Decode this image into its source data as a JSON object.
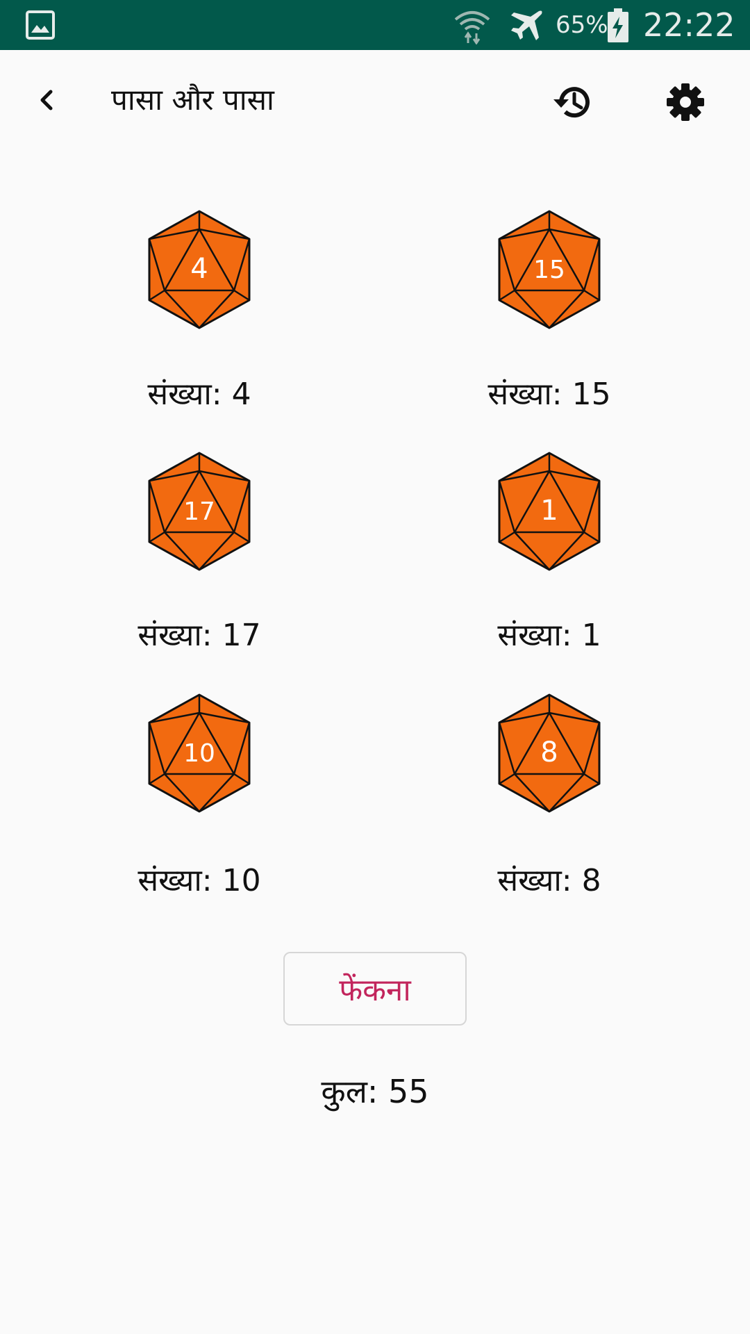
{
  "status_bar": {
    "battery_percent": "65%",
    "time": "22:22",
    "icons": [
      "gallery-icon",
      "wifi-icon",
      "airplane-mode-icon",
      "battery-charging-icon"
    ]
  },
  "toolbar": {
    "title": "पासा और पासा",
    "icons": [
      "back-arrow-icon",
      "history-icon",
      "settings-icon"
    ]
  },
  "dice": [
    {
      "face": "4",
      "label": "संख्या: 4"
    },
    {
      "face": "15",
      "label": "संख्या: 15"
    },
    {
      "face": "17",
      "label": "संख्या: 17"
    },
    {
      "face": "1",
      "label": "संख्या: 1"
    },
    {
      "face": "10",
      "label": "संख्या: 10"
    },
    {
      "face": "8",
      "label": "संख्या: 8"
    }
  ],
  "roll_button": {
    "label": "फेंकना"
  },
  "total": "कुल: 55",
  "colors": {
    "status_bar": "#02594b",
    "die_fill": "#f26a10",
    "roll_button_text": "#c2255c",
    "background": "#fafafa"
  }
}
